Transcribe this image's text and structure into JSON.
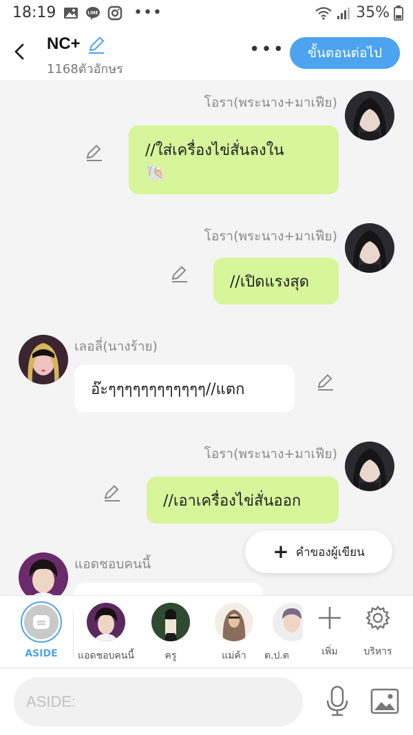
{
  "status_bar": {
    "time": "18:19",
    "battery": "35%",
    "icons": [
      "gallery-icon",
      "line-icon",
      "instagram-icon",
      "more-dots-icon",
      "wifi-icon",
      "signal-icon",
      "battery-icon"
    ]
  },
  "header": {
    "title": "NC+",
    "subtitle": "1168ตัวอักษร",
    "next_button": "ขั้นตอนต่อไป",
    "more": "•••"
  },
  "messages": [
    {
      "side": "right",
      "sender": "โอรา(พระนาง+มาเฟีย)",
      "text": "//ใส่เครื่องไข่สั่นลงใน",
      "emoji": "🐚",
      "style": "green"
    },
    {
      "side": "right",
      "sender": "โอรา(พระนาง+มาเฟีย)",
      "text": "//เปิดแรงสุด",
      "style": "green"
    },
    {
      "side": "left",
      "sender": "เลอลี่(นางร้าย)",
      "text": "อ๊ะๆๆๆๆๆๆๆๆๆๆๆๆ//แตก",
      "style": "white"
    },
    {
      "side": "right",
      "sender": "โอรา(พระนาง+มาเฟีย)",
      "text": "//เอาเครื่องไข่สั่นออก",
      "style": "green"
    },
    {
      "side": "left",
      "sender": "แอดชอบคนนี้",
      "text": "",
      "style": "white"
    }
  ],
  "fab": {
    "label": "คำของผู้เขียน",
    "plus": "+"
  },
  "characters": [
    {
      "label": "ASIDE",
      "active": true
    },
    {
      "label": "แอดชอบคนนี้"
    },
    {
      "label": "ครู"
    },
    {
      "label": "แม่ค้า"
    },
    {
      "label": "ต.ป.ต"
    }
  ],
  "bar_actions": {
    "add": "เพิ่ม",
    "manage": "บริหาร"
  },
  "input": {
    "placeholder": "ASIDE:"
  },
  "colors": {
    "accent": "#4da3ee",
    "green_bubble": "#d7f59b",
    "background": "#f4f4f4"
  }
}
